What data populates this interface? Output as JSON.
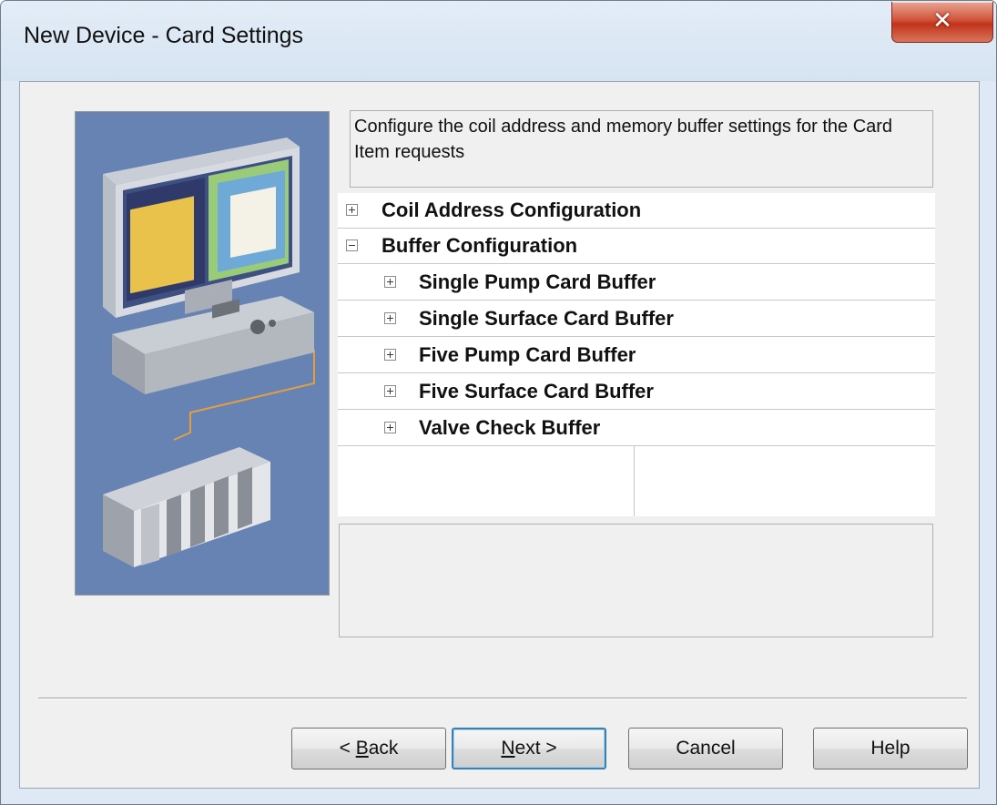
{
  "window": {
    "title": "New Device - Card Settings",
    "close_icon": "close-icon"
  },
  "description": "Configure the coil address and memory buffer settings for the Card Item requests",
  "properties": [
    {
      "label": "Coil Address Configuration",
      "expanded": false,
      "level": 0
    },
    {
      "label": "Buffer Configuration",
      "expanded": true,
      "level": 0
    },
    {
      "label": "Single Pump Card Buffer",
      "expanded": false,
      "level": 1
    },
    {
      "label": "Single Surface Card Buffer",
      "expanded": false,
      "level": 1
    },
    {
      "label": "Five Pump Card Buffer",
      "expanded": false,
      "level": 1
    },
    {
      "label": "Five Surface Card Buffer",
      "expanded": false,
      "level": 1
    },
    {
      "label": "Valve Check Buffer",
      "expanded": false,
      "level": 1
    }
  ],
  "buttons": {
    "back": {
      "label": "< Back",
      "mnemonic": "B"
    },
    "next": {
      "label": "Next >",
      "mnemonic": "N"
    },
    "cancel": {
      "label": "Cancel"
    },
    "help": {
      "label": "Help"
    }
  },
  "colors": {
    "close_red": "#c0331a",
    "illustration_bg": "#6783b3",
    "default_button_border": "#3c7fb1"
  }
}
